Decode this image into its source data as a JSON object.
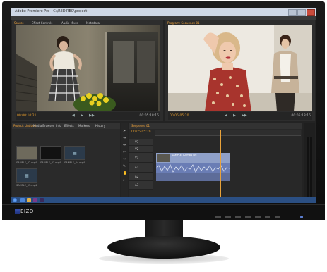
{
  "brand": {
    "logo_text": "EIZO"
  },
  "app": {
    "window_title": "Adobe Premiere Pro - C:\\REDIREC\\project",
    "menu": [
      "File",
      "Edit",
      "Project",
      "Clip",
      "Sequence",
      "Marker",
      "Title",
      "Window",
      "Help"
    ]
  },
  "source_monitor": {
    "tabs": [
      "Source",
      "Effect Controls",
      "Audio Mixer",
      "Metadata"
    ],
    "timecode_in": "00:00:10:21",
    "timecode_out": "00:05:18:15"
  },
  "program_monitor": {
    "tabs": [
      "Program: Sequence 01"
    ],
    "timecode_in": "00:05:05:20",
    "timecode_out": "00:05:18:15"
  },
  "project_panel": {
    "tabs": [
      "Project: Untitled",
      "Media Browser",
      "Info",
      "Effects",
      "Markers",
      "History"
    ],
    "clips": [
      "SAMPLE_02.mp4",
      "SAMPLE_03.mp4",
      "SAMPLE_04.mp4",
      "SAMPLE_05.mp4"
    ]
  },
  "timeline": {
    "tab": "Sequence 01",
    "timecode": "00:05:05:20",
    "tracks": [
      "V3",
      "V2",
      "V1",
      "A1",
      "A2",
      "A3"
    ],
    "clip_label": "SAMPLE_02.mp4 [V]"
  },
  "colors": {
    "accent": "#e39b2d",
    "bezel": "#111111",
    "taskbar": "#2b4f83"
  }
}
